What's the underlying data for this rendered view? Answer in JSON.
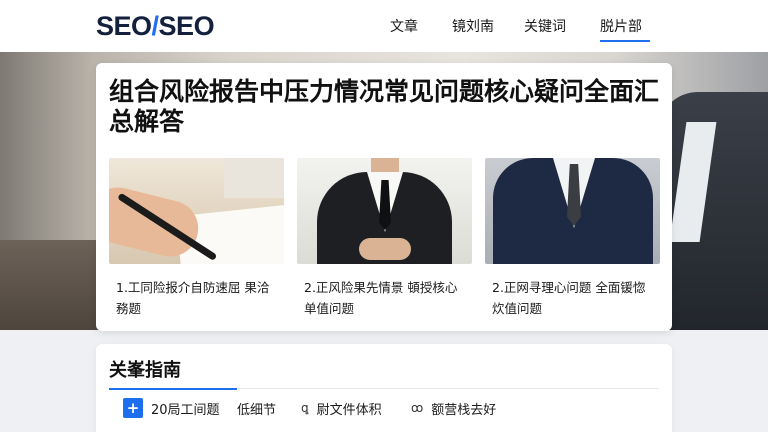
{
  "header": {
    "logo": {
      "part_a": "SEO",
      "part_b": "/",
      "part_c": "SEO"
    },
    "nav": [
      {
        "label": "文章"
      },
      {
        "label": "镜刘南"
      },
      {
        "label": "关键词"
      },
      {
        "label": "脱片部",
        "active": true
      }
    ]
  },
  "hero": {
    "title": "组合风险报告中压力情况常见问题核心疑问全面汇总解答",
    "articles": [
      {
        "caption": "1.工同险报介自防速屈 果洽務题",
        "image": "hand-writing-pen"
      },
      {
        "caption": "2.正风险果先情景 頓授核心单值问题",
        "image": "man-in-black-suit"
      },
      {
        "caption": "2.正网寻理心问题 全面锾惚炊值问题",
        "image": "man-in-navy-suit"
      }
    ]
  },
  "section": {
    "title": "关峯指南",
    "tabs": [
      {
        "label": "20局工间题",
        "icon": "plus-icon",
        "active": true
      },
      {
        "label": "低细节"
      },
      {
        "label": "尉文件体积",
        "icon_glyph": "ꝗ"
      },
      {
        "label": "额营栈去好",
        "icon_glyph": "ꝏ"
      }
    ]
  },
  "colors": {
    "accent": "#1e6ff0",
    "logo_dark": "#14213d"
  }
}
